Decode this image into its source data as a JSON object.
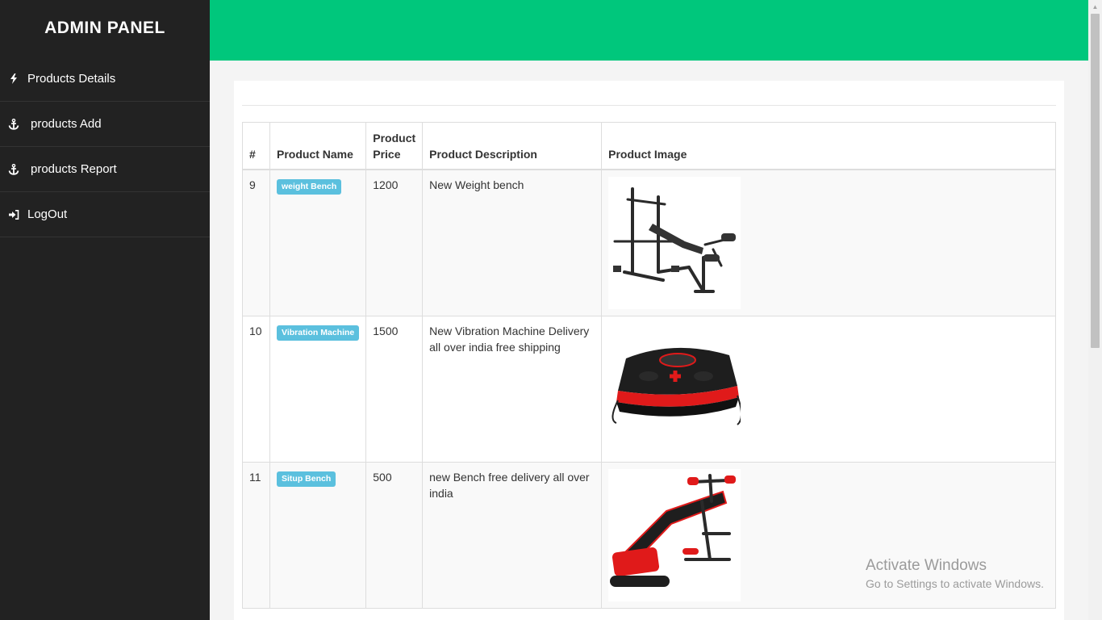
{
  "sidebar": {
    "brand": "ADMIN PANEL",
    "items": [
      {
        "label": "Products Details",
        "icon": "bolt-icon"
      },
      {
        "label": "products Add",
        "icon": "anchor-icon"
      },
      {
        "label": "products Report",
        "icon": "anchor-icon"
      },
      {
        "label": "LogOut",
        "icon": "sign-in-icon"
      }
    ]
  },
  "colors": {
    "topbar": "#00c77c",
    "sidebar": "#222222",
    "badge": "#5bc0de"
  },
  "table": {
    "headers": {
      "index": "#",
      "name": "Product Name",
      "price": "Product Price",
      "description": "Product Description",
      "image": "Product Image"
    },
    "rows": [
      {
        "id": "9",
        "name": "weight Bench",
        "price": "1200",
        "description": "New Weight bench",
        "image": "weight-bench-image"
      },
      {
        "id": "10",
        "name": "Vibration Machine",
        "price": "1500",
        "description": "New Vibration Machine Delivery all over india free shipping",
        "image": "vibration-machine-image"
      },
      {
        "id": "11",
        "name": "Situp Bench",
        "price": "500",
        "description": "new Bench free delivery all over india",
        "image": "situp-bench-image"
      }
    ]
  },
  "watermark": {
    "title": "Activate Windows",
    "subtitle": "Go to Settings to activate Windows."
  }
}
